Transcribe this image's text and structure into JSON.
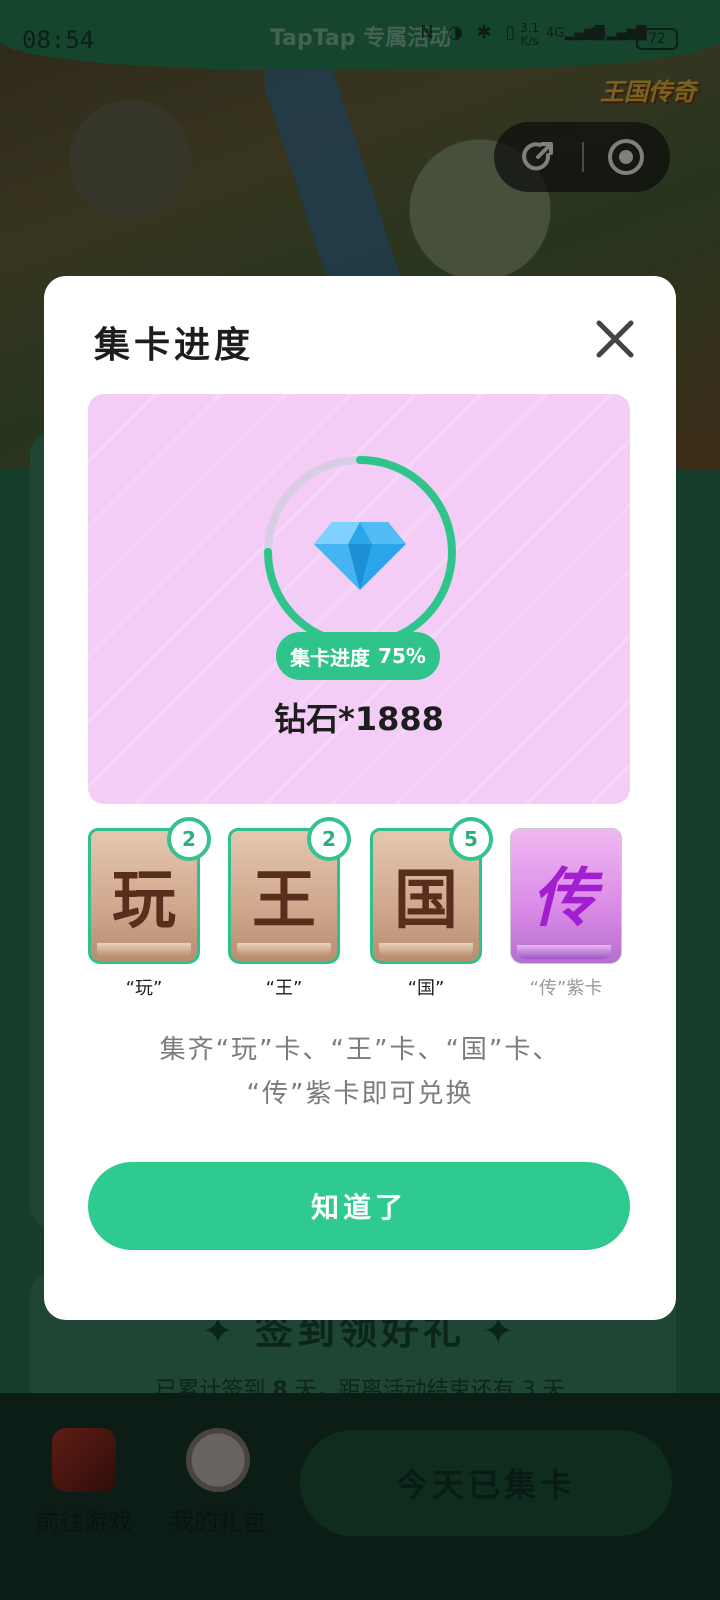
{
  "status_bar": {
    "time": "08:54",
    "brand_text": "TapTap 专属活动",
    "net_speed_value": "3.1",
    "net_speed_unit": "K/s",
    "signal_1": "4G",
    "signal_2": "4G",
    "battery": "72"
  },
  "header": {
    "game_logo": "王国传奇"
  },
  "background": {
    "sign_title": "签到领好礼",
    "sign_subtitle_pre": "已累计签到",
    "sign_days": "8",
    "sign_subtitle_post": "天，距离活动结束还有 3 天"
  },
  "bottom_bar": {
    "go_game_label": "前往游戏",
    "my_gifts_label": "我的礼包",
    "today_button": "今天已集卡"
  },
  "modal": {
    "title": "集卡进度",
    "progress_label": "集卡进度",
    "progress_value": "75%",
    "progress_fraction": 0.75,
    "reward_text": "钻石*1888",
    "cards": [
      {
        "char": "玩",
        "label": "“玩”",
        "count": "2",
        "type": "normal"
      },
      {
        "char": "王",
        "label": "“王”",
        "count": "2",
        "type": "normal"
      },
      {
        "char": "国",
        "label": "“国”",
        "count": "5",
        "type": "normal"
      },
      {
        "char": "传",
        "label": "“传”紫卡",
        "count": "",
        "type": "purple"
      }
    ],
    "description_line1": "集齐“玩”卡、“王”卡、“国”卡、",
    "description_line2": "“传”紫卡即可兑换",
    "confirm_button": "知道了"
  },
  "colors": {
    "accent_green": "#2fca8f",
    "panel_pink": "#f4cdf7",
    "purple_card": "#a21fd1"
  }
}
